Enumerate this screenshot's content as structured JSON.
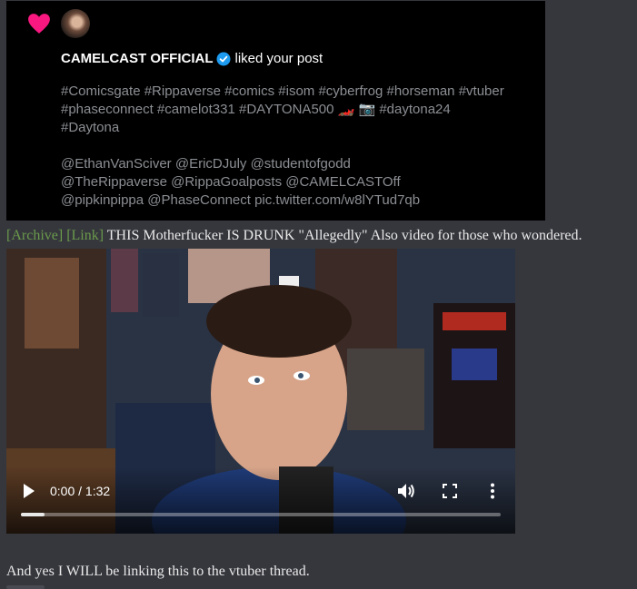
{
  "notification": {
    "account": "CAMELCAST OFFICIAL",
    "action": "liked your post",
    "tweet_lines": [
      "#Comicsgate #Rippaverse #comics #isom #cyberfrog #horseman #vtuber",
      "#phaseconnect #camelot331 #DAYTONA500 🏎️ 📷 #daytona24",
      "#Daytona",
      "",
      "@EthanVanSciver @EricDJuly @studentofgodd",
      "@TheRippaverse @RippaGoalposts @CAMELCASTOff",
      "@pipkinpippa @PhaseConnect pic.twitter.com/w8lYTud7qb"
    ],
    "icons": {
      "heart": "heart-icon",
      "verified": "verified-badge-icon"
    },
    "colors": {
      "heart": "#f91880",
      "verified": "#1d9bf0"
    }
  },
  "post": {
    "archive_link": "[Archive]",
    "link": "[Link]",
    "text": "THIS Motherfucker IS DRUNK \"Allegedly\" Also video for those who wondered."
  },
  "video": {
    "time": "0:00 / 1:32",
    "progress": 0.05
  },
  "footer_text": "And yes I WILL be linking this to the vtuber thread."
}
